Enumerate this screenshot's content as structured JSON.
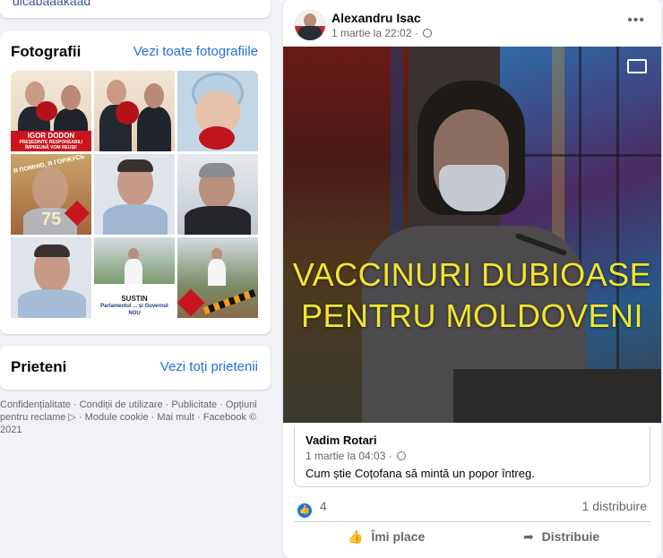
{
  "left": {
    "top_stub_text": "dicabaaakaad",
    "photos": {
      "title": "Fotografii",
      "see_all": "Vezi toate fotografiile",
      "items": [
        {
          "caption_1": "IGOR DODON",
          "caption_2": "PREȘEDINTE RESPONSABIL! ÎMPREUNĂ VOM REUȘI!"
        },
        {},
        {},
        {
          "caption_1": "Я ПОМНЮ, Я ГОРЖУСЬ",
          "caption_2": "75"
        },
        {},
        {},
        {},
        {
          "caption_1": "SUSTIN",
          "caption_2": "Parlamentul ... și Guvernul NOU"
        },
        {}
      ]
    },
    "friends": {
      "title": "Prieteni",
      "see_all": "Vezi toți prietenii"
    },
    "footer": "Confidențialitate · Condiții de utilizare · Publicitate · Opțiuni pentru reclame ▷ · Module cookie · Mai mult · Facebook © 2021"
  },
  "post": {
    "author": "Alexandru Isac",
    "time": "1 martie la 22:02 ·",
    "more": "•••",
    "video_text_1": "VACCINURI DUBIOASE",
    "video_text_2": "PENTRU MOLDOVENI",
    "video_icon": "cast-icon",
    "shared": {
      "author": "Vadim Rotari",
      "time": "1 martie la 04:03 ·",
      "text": "Cum știe Coțofana să mintă un popor întreg."
    },
    "reaction_count": "4",
    "shares": "1 distribuire",
    "like_label": "Îmi place",
    "share_label": "Distribuie",
    "colors": {
      "accent": "#216fdb",
      "video_text": "#f2e52c",
      "like": "#1b74e4"
    }
  }
}
